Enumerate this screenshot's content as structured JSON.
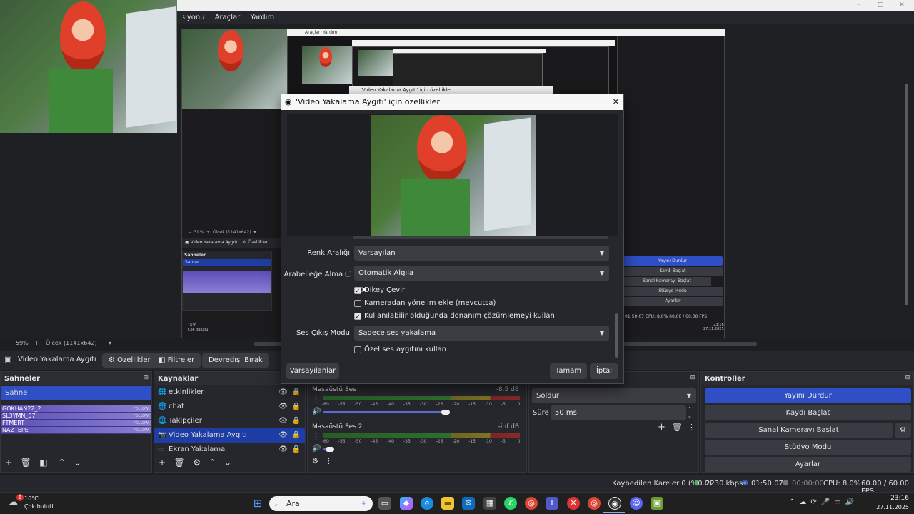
{
  "menu": [
    "ksiyonu",
    "Araçlar",
    "Yardım"
  ],
  "nested_menu": [
    "Araçlar",
    "Yardım"
  ],
  "nested_dialog_title": "'Video Yakalama Aygıtı' için özellikler",
  "nested_toolbar": {
    "source": "Video Yakalama Aygıtı",
    "props": "Özellikler",
    "scenes": "Sahneler",
    "scene": "Sahne"
  },
  "nested_controls": [
    "Yayını Durdur",
    "Kaydı Başlat",
    "Sanal Kamerayı Başlat",
    "Stüdyo Modu",
    "Ayarlar"
  ],
  "nested_status": "01:50:07   CPU: 8.0%   60.00 / 60.00 FPS",
  "nested_clock": [
    "23:16",
    "27.11.2025"
  ],
  "nested_weather": [
    "16°C",
    "Çok bulutlu"
  ],
  "zoom": {
    "percent": "59%",
    "scale": "Ölçek (1141x642)"
  },
  "source_toolbar": {
    "current_source": "Video Yakalama Aygıtı",
    "properties": "Özellikler",
    "filters": "Filtreler",
    "deactivate": "Devredışı Bırak"
  },
  "scenes": {
    "title": "Sahneler",
    "selected": "Sahne",
    "follow_items": [
      {
        "name": "GOKHAN22_2",
        "tag": "FOLLOW"
      },
      {
        "name": "SL3YMN_07",
        "tag": "FOLLOW"
      },
      {
        "name": "FTMERT",
        "tag": "FOLLOW"
      },
      {
        "name": "NAZTEPE",
        "tag": "FOLLOW"
      }
    ]
  },
  "sources": {
    "title": "Kaynaklar",
    "items": [
      {
        "label": "etkinlikler",
        "icon": "globe-icon"
      },
      {
        "label": "chat",
        "icon": "globe-icon"
      },
      {
        "label": "Takipçiler",
        "icon": "globe-icon"
      },
      {
        "label": "Video Yakalama Aygıtı",
        "icon": "camera-icon"
      },
      {
        "label": "Ekran Yakalama",
        "icon": "monitor-icon"
      }
    ]
  },
  "mixer": {
    "channels": [
      {
        "name": "Masaüstü Ses",
        "db": "-8.5 dB",
        "level": 0.62
      },
      {
        "name": "Masaüstü Ses 2",
        "db": "-inf dB",
        "level": 0.02
      }
    ],
    "ticks": [
      "-60",
      "-55",
      "-50",
      "-45",
      "-40",
      "-35",
      "-30",
      "-25",
      "-20",
      "-15",
      "-10",
      "-5",
      "0"
    ]
  },
  "transitions": {
    "mode": "Soldur",
    "duration_label": "Süre",
    "duration": "50 ms"
  },
  "controls": {
    "title": "Kontroller",
    "stop_stream": "Yayını Durdur",
    "start_record": "Kaydı Başlat",
    "virtual_cam": "Sanal Kamerayı Başlat",
    "studio": "Stüdyo Modu",
    "settings": "Ayarlar"
  },
  "status": {
    "dropped": "Kaybedilen Kareler 0 (%0.0)",
    "bitrate": "2230 kbps",
    "stream_time": "01:50:07",
    "rec_time": "00:00:00",
    "cpu": "CPU: 8.0%",
    "fps": "60.00 / 60.00 FPS"
  },
  "dialog": {
    "title": "'Video Yakalama Aygıtı' için özellikler",
    "color_range_label": "Renk Aralığı",
    "color_range_value": "Varsayılan",
    "buffering_label": "Arabelleğe Alma",
    "buffering_value": "Otomatik Algıla",
    "flip_vertical": "Dikey Çevir",
    "add_orientation": "Kameradan yönelim ekle (mevcutsa)",
    "hw_decode": "Kullanılabilir olduğunda donanım çözümlemeyi kullan",
    "audio_mode_label": "Ses Çıkış Modu",
    "audio_mode_value": "Sadece ses yakalama",
    "custom_audio": "Özel ses aygıtını kullan",
    "defaults_btn": "Varsayılanlar",
    "ok_btn": "Tamam",
    "cancel_btn": "İptal",
    "checks": {
      "flip_vertical": true,
      "add_orientation": false,
      "hw_decode": true,
      "custom_audio": false
    }
  },
  "taskbar": {
    "weather_temp": "16°C",
    "weather_desc": "Çok bulutlu",
    "weather_badge": "6",
    "search_placeholder": "Ara",
    "time": "23:16",
    "date": "27.11.2025"
  }
}
